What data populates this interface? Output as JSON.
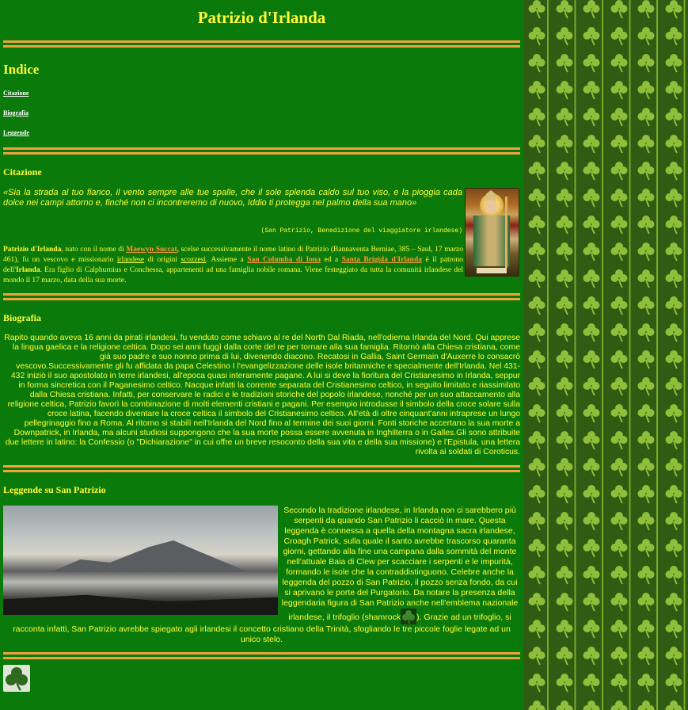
{
  "page": {
    "title": "Patrizio d'Irlanda",
    "colors": {
      "background": "#0a7a0a",
      "text": "#ffff33",
      "rule": "#f2a23c",
      "link": "#ff9933"
    }
  },
  "index": {
    "heading": "Indice",
    "links": [
      "Citazione",
      "Biografia",
      "Leggende"
    ]
  },
  "citazione": {
    "heading": "Citazione",
    "quote": "«Sia la strada al tuo fianco, il vento sempre alle tue spalle, che il sole splenda caldo sul tuo viso, e la pioggia cada dolce nei campi attorno e, finché non ci incontreremo di nuovo, Iddio ti protegga nel palmo della sua mano»",
    "source": "(San Patrizio, Benedizione del viaggiatore irlandese)",
    "intro": {
      "name": "Patrizio d'Irlanda",
      "t1": ", nato con il nome di ",
      "link_maewyn": "Maewyn Succat",
      "t2": ", scelse successivamente il nome latino di Patrizio (Bannaventa Berniae, 385 – Saul, 17 marzo 461), fu un vescovo e missionario ",
      "link_irlandese": "irlandese",
      "t3": " di origini ",
      "link_scozzesi": "scozzesi",
      "t4": ". Assieme a ",
      "link_columba": "San Columba di Iona",
      "t5": " ed a ",
      "link_brigida": "Santa Brigida d'Irlanda",
      "t6": " è il patrono dell'",
      "bold_irlanda": "Irlanda",
      "t7": ". Era figlio di Calphurnius e Conchessa, appartenenti ad una famiglia nobile romana. Viene festeggiato da tutta la comunità irlandese del mondo il 17 marzo, data della sua morte."
    }
  },
  "biografia": {
    "heading": "Biografia",
    "text": "Rapito quando aveva 16 anni da pirati irlandesi, fu venduto come schiavo al re del North Dal Riada, nell'odierna Irlanda del Nord. Qui apprese la lingua gaelica e la religione celtica. Dopo sei anni fuggì dalla corte del re per tornare alla sua famiglia. Ritornò alla Chiesa cristiana, come già suo padre e suo nonno prima di lui, divenendo diacono. Recatosi in Gallia, Saint Germain d'Auxerre lo consacrò vescovo.Successivamente gli fu affidata da papa Celestino I l'evangelizzazione delle isole britanniche e specialmente dell'Irlanda. Nel 431-432 iniziò il suo apostolato in terre irlandesi, all'epoca quasi interamente pagane. A lui si deve la fioritura del Cristianesimo in Irlanda, seppur in forma sincretica con il Paganesimo celtico. Nacque infatti la corrente separata del Cristianesimo celtico, in seguito limitato e riassimilato dalla Chiesa cristiana. Infatti, per conservare le radici e le tradizioni storiche del popolo irlandese, nonché per un suo attaccamento alla religione celtica, Patrizio favorì la combinazione di molti elementi cristiani e pagani. Per esempio introdusse il simbolo della croce solare sulla croce latina, facendo diventare la croce celtica il simbolo del Cristianesimo celtico. All'età di oltre cinquant'anni intraprese un lungo pellegrinaggio fino a Roma. Al ritorno si stabilì nell'Irlanda del Nord fino al termine dei suoi giorni. Fonti storiche accertano la sua morte a Downpatrick, in Irlanda, ma alcuni studiosi suppongono che la sua morte possa essere avvenuta in Inghilterra o in Galles.Gli sono attribuite due lettere in latino: la Confessio (o \"Dichiarazione\" in cui offre un breve resoconto della sua vita e della sua missione) e l'Epistula, una lettera rivolta ai soldati di Coroticus."
  },
  "leggende": {
    "heading": "Leggende su San Patrizio",
    "text_before": "Secondo la tradizione irlandese, in Irlanda non ci sarebbero più serpenti da quando San Patrizio li cacciò in mare. Questa leggenda è connessa a quella della montagna sacra irlandese, Croagh Patrick, sulla quale il santo avrebbe trascorso quaranta giorni, gettando alla fine una campana dalla sommità del monte nell'attuale Baia di Clew per scacciare i serpenti e le impurità, formando le isole che la contraddistinguono. Celebre anche la leggenda del pozzo di San Patrizio, il pozzo senza fondo, da cui si aprivano le porte del Purgatorio. Da notare la presenza della leggendaria figura di San Patrizio anche nell'emblema nazionale irlandese, il trifoglio (shamrock",
    "text_after": "). Grazie ad un trifoglio, si racconta infatti, San Patrizio avrebbe spiegato agli irlandesi il concetto cristiano della Trinità, sfogliando le tre piccole foglie legate ad un unico stelo."
  }
}
